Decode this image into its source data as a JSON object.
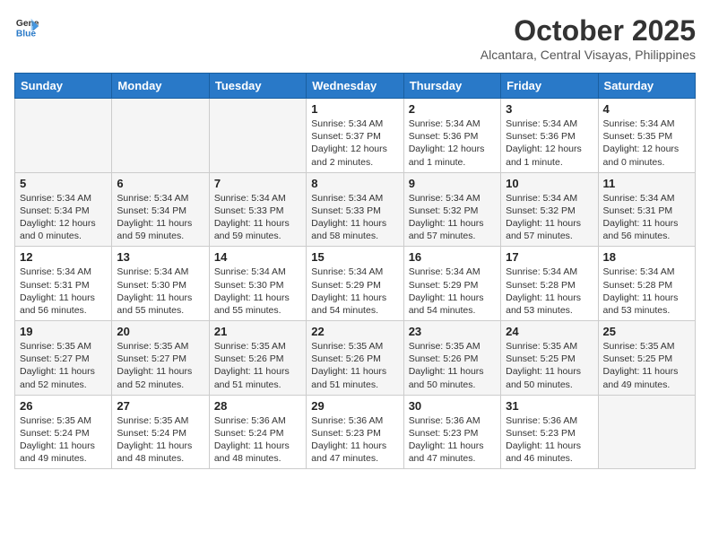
{
  "header": {
    "logo_general": "General",
    "logo_blue": "Blue",
    "month": "October 2025",
    "location": "Alcantara, Central Visayas, Philippines"
  },
  "days_of_week": [
    "Sunday",
    "Monday",
    "Tuesday",
    "Wednesday",
    "Thursday",
    "Friday",
    "Saturday"
  ],
  "weeks": [
    [
      {
        "day": "",
        "info": ""
      },
      {
        "day": "",
        "info": ""
      },
      {
        "day": "",
        "info": ""
      },
      {
        "day": "1",
        "info": "Sunrise: 5:34 AM\nSunset: 5:37 PM\nDaylight: 12 hours\nand 2 minutes."
      },
      {
        "day": "2",
        "info": "Sunrise: 5:34 AM\nSunset: 5:36 PM\nDaylight: 12 hours\nand 1 minute."
      },
      {
        "day": "3",
        "info": "Sunrise: 5:34 AM\nSunset: 5:36 PM\nDaylight: 12 hours\nand 1 minute."
      },
      {
        "day": "4",
        "info": "Sunrise: 5:34 AM\nSunset: 5:35 PM\nDaylight: 12 hours\nand 0 minutes."
      }
    ],
    [
      {
        "day": "5",
        "info": "Sunrise: 5:34 AM\nSunset: 5:34 PM\nDaylight: 12 hours\nand 0 minutes."
      },
      {
        "day": "6",
        "info": "Sunrise: 5:34 AM\nSunset: 5:34 PM\nDaylight: 11 hours\nand 59 minutes."
      },
      {
        "day": "7",
        "info": "Sunrise: 5:34 AM\nSunset: 5:33 PM\nDaylight: 11 hours\nand 59 minutes."
      },
      {
        "day": "8",
        "info": "Sunrise: 5:34 AM\nSunset: 5:33 PM\nDaylight: 11 hours\nand 58 minutes."
      },
      {
        "day": "9",
        "info": "Sunrise: 5:34 AM\nSunset: 5:32 PM\nDaylight: 11 hours\nand 57 minutes."
      },
      {
        "day": "10",
        "info": "Sunrise: 5:34 AM\nSunset: 5:32 PM\nDaylight: 11 hours\nand 57 minutes."
      },
      {
        "day": "11",
        "info": "Sunrise: 5:34 AM\nSunset: 5:31 PM\nDaylight: 11 hours\nand 56 minutes."
      }
    ],
    [
      {
        "day": "12",
        "info": "Sunrise: 5:34 AM\nSunset: 5:31 PM\nDaylight: 11 hours\nand 56 minutes."
      },
      {
        "day": "13",
        "info": "Sunrise: 5:34 AM\nSunset: 5:30 PM\nDaylight: 11 hours\nand 55 minutes."
      },
      {
        "day": "14",
        "info": "Sunrise: 5:34 AM\nSunset: 5:30 PM\nDaylight: 11 hours\nand 55 minutes."
      },
      {
        "day": "15",
        "info": "Sunrise: 5:34 AM\nSunset: 5:29 PM\nDaylight: 11 hours\nand 54 minutes."
      },
      {
        "day": "16",
        "info": "Sunrise: 5:34 AM\nSunset: 5:29 PM\nDaylight: 11 hours\nand 54 minutes."
      },
      {
        "day": "17",
        "info": "Sunrise: 5:34 AM\nSunset: 5:28 PM\nDaylight: 11 hours\nand 53 minutes."
      },
      {
        "day": "18",
        "info": "Sunrise: 5:34 AM\nSunset: 5:28 PM\nDaylight: 11 hours\nand 53 minutes."
      }
    ],
    [
      {
        "day": "19",
        "info": "Sunrise: 5:35 AM\nSunset: 5:27 PM\nDaylight: 11 hours\nand 52 minutes."
      },
      {
        "day": "20",
        "info": "Sunrise: 5:35 AM\nSunset: 5:27 PM\nDaylight: 11 hours\nand 52 minutes."
      },
      {
        "day": "21",
        "info": "Sunrise: 5:35 AM\nSunset: 5:26 PM\nDaylight: 11 hours\nand 51 minutes."
      },
      {
        "day": "22",
        "info": "Sunrise: 5:35 AM\nSunset: 5:26 PM\nDaylight: 11 hours\nand 51 minutes."
      },
      {
        "day": "23",
        "info": "Sunrise: 5:35 AM\nSunset: 5:26 PM\nDaylight: 11 hours\nand 50 minutes."
      },
      {
        "day": "24",
        "info": "Sunrise: 5:35 AM\nSunset: 5:25 PM\nDaylight: 11 hours\nand 50 minutes."
      },
      {
        "day": "25",
        "info": "Sunrise: 5:35 AM\nSunset: 5:25 PM\nDaylight: 11 hours\nand 49 minutes."
      }
    ],
    [
      {
        "day": "26",
        "info": "Sunrise: 5:35 AM\nSunset: 5:24 PM\nDaylight: 11 hours\nand 49 minutes."
      },
      {
        "day": "27",
        "info": "Sunrise: 5:35 AM\nSunset: 5:24 PM\nDaylight: 11 hours\nand 48 minutes."
      },
      {
        "day": "28",
        "info": "Sunrise: 5:36 AM\nSunset: 5:24 PM\nDaylight: 11 hours\nand 48 minutes."
      },
      {
        "day": "29",
        "info": "Sunrise: 5:36 AM\nSunset: 5:23 PM\nDaylight: 11 hours\nand 47 minutes."
      },
      {
        "day": "30",
        "info": "Sunrise: 5:36 AM\nSunset: 5:23 PM\nDaylight: 11 hours\nand 47 minutes."
      },
      {
        "day": "31",
        "info": "Sunrise: 5:36 AM\nSunset: 5:23 PM\nDaylight: 11 hours\nand 46 minutes."
      },
      {
        "day": "",
        "info": ""
      }
    ]
  ]
}
